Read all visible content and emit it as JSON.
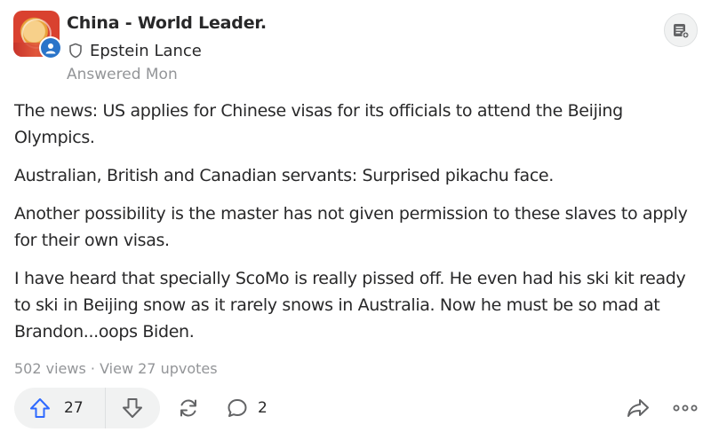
{
  "header": {
    "space_name": "China - World Leader.",
    "author_name": "Epstein Lance",
    "answered": "Answered Mon"
  },
  "content": {
    "paragraphs": [
      "The news: US applies for Chinese visas for its officials to attend the Beijing Olympics.",
      "Australian, British and Canadian servants: Surprised pikachu face.",
      "Another possibility is the master has not given permission to these slaves to apply for their own visas.",
      "I have heard that specially ScoMo is really pissed off. He even had his ski kit ready to ski in Beijing snow as it rarely snows in Australia. Now he must be so mad at Brandon...oops Biden."
    ]
  },
  "stats": {
    "text": "502 views · View 27 upvotes"
  },
  "actions": {
    "upvote_count": "27",
    "comment_count": "2"
  },
  "icons": {
    "shield": "shield-icon",
    "follow": "follow-space-icon",
    "upvote": "arrow-up-icon",
    "downvote": "arrow-down-icon",
    "share": "reshare-icon",
    "comment": "comment-icon",
    "forward": "share-arrow-icon",
    "more": "more-options-icon"
  },
  "colors": {
    "upvote_blue": "#2e69ff",
    "text": "#282829",
    "muted": "#939598",
    "pill_bg": "#f1f2f2"
  }
}
